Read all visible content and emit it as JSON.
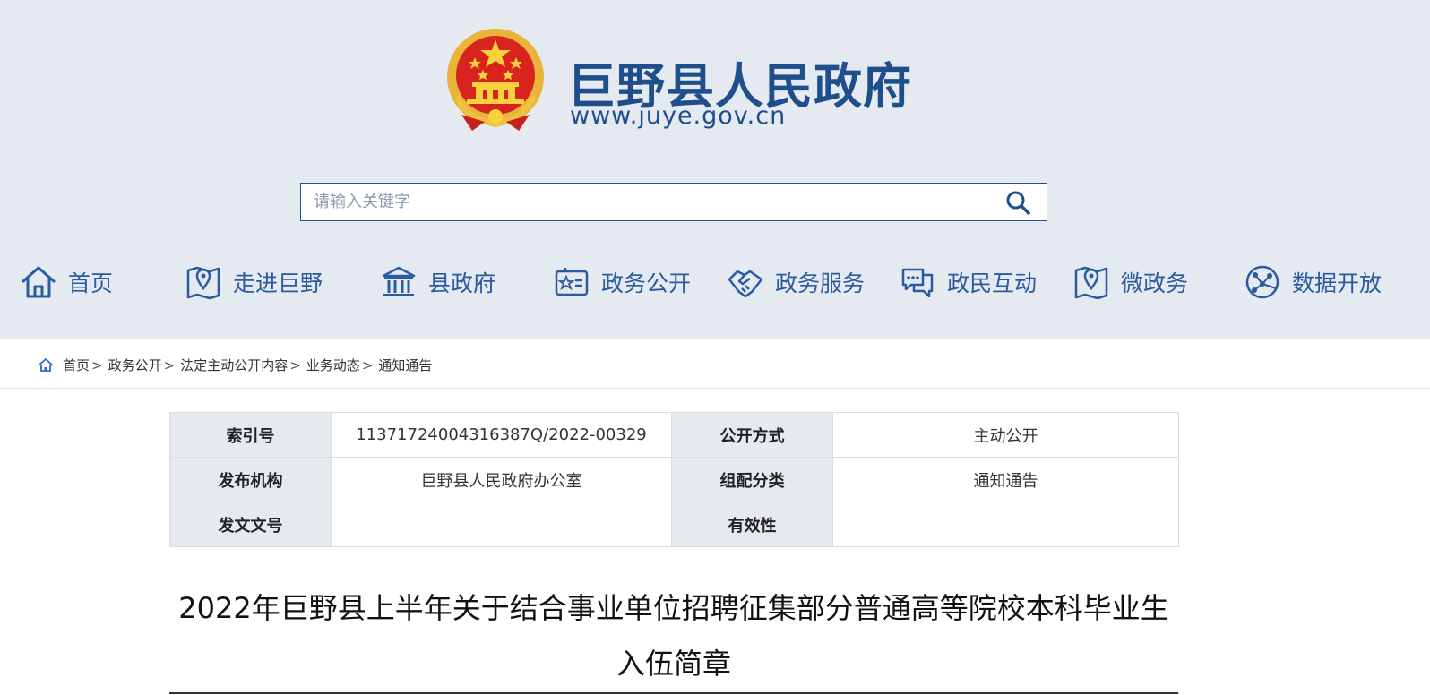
{
  "header": {
    "site_name": "巨野县人民政府",
    "site_url": "www.juye.gov.cn",
    "emblem_icon": "national-emblem-icon",
    "brand_color": "#1f4e8c",
    "background": "#e5e9f0"
  },
  "search": {
    "placeholder": "请输入关键字",
    "value": "",
    "icon": "search-icon"
  },
  "nav": {
    "items": [
      {
        "label": "首页",
        "icon": "home-icon"
      },
      {
        "label": "走进巨野",
        "icon": "map-pin-icon"
      },
      {
        "label": "县政府",
        "icon": "government-building-icon"
      },
      {
        "label": "政务公开",
        "icon": "star-card-icon"
      },
      {
        "label": "政务服务",
        "icon": "handshake-icon"
      },
      {
        "label": "政民互动",
        "icon": "chat-bubbles-icon"
      },
      {
        "label": "微政务",
        "icon": "map-pin-icon"
      },
      {
        "label": "数据开放",
        "icon": "globe-network-icon"
      }
    ]
  },
  "breadcrumb": {
    "icon": "home-icon",
    "items": [
      "首页",
      "政务公开",
      "法定主动公开内容",
      "业务动态",
      "通知通告"
    ],
    "separator": ">"
  },
  "meta": {
    "index_label": "索引号",
    "index_value": "11371724004316387Q/2022-00329",
    "disclosure_label": "公开方式",
    "disclosure_value": "主动公开",
    "issuer_label": "发布机构",
    "issuer_value": "巨野县人民政府办公室",
    "category_label": "组配分类",
    "category_value": "通知通告",
    "docnum_label": "发文文号",
    "docnum_value": "",
    "validity_label": "有效性",
    "validity_value": ""
  },
  "article": {
    "title": "2022年巨野县上半年关于结合事业单位招聘征集部分普通高等院校本科毕业生入伍简章"
  }
}
